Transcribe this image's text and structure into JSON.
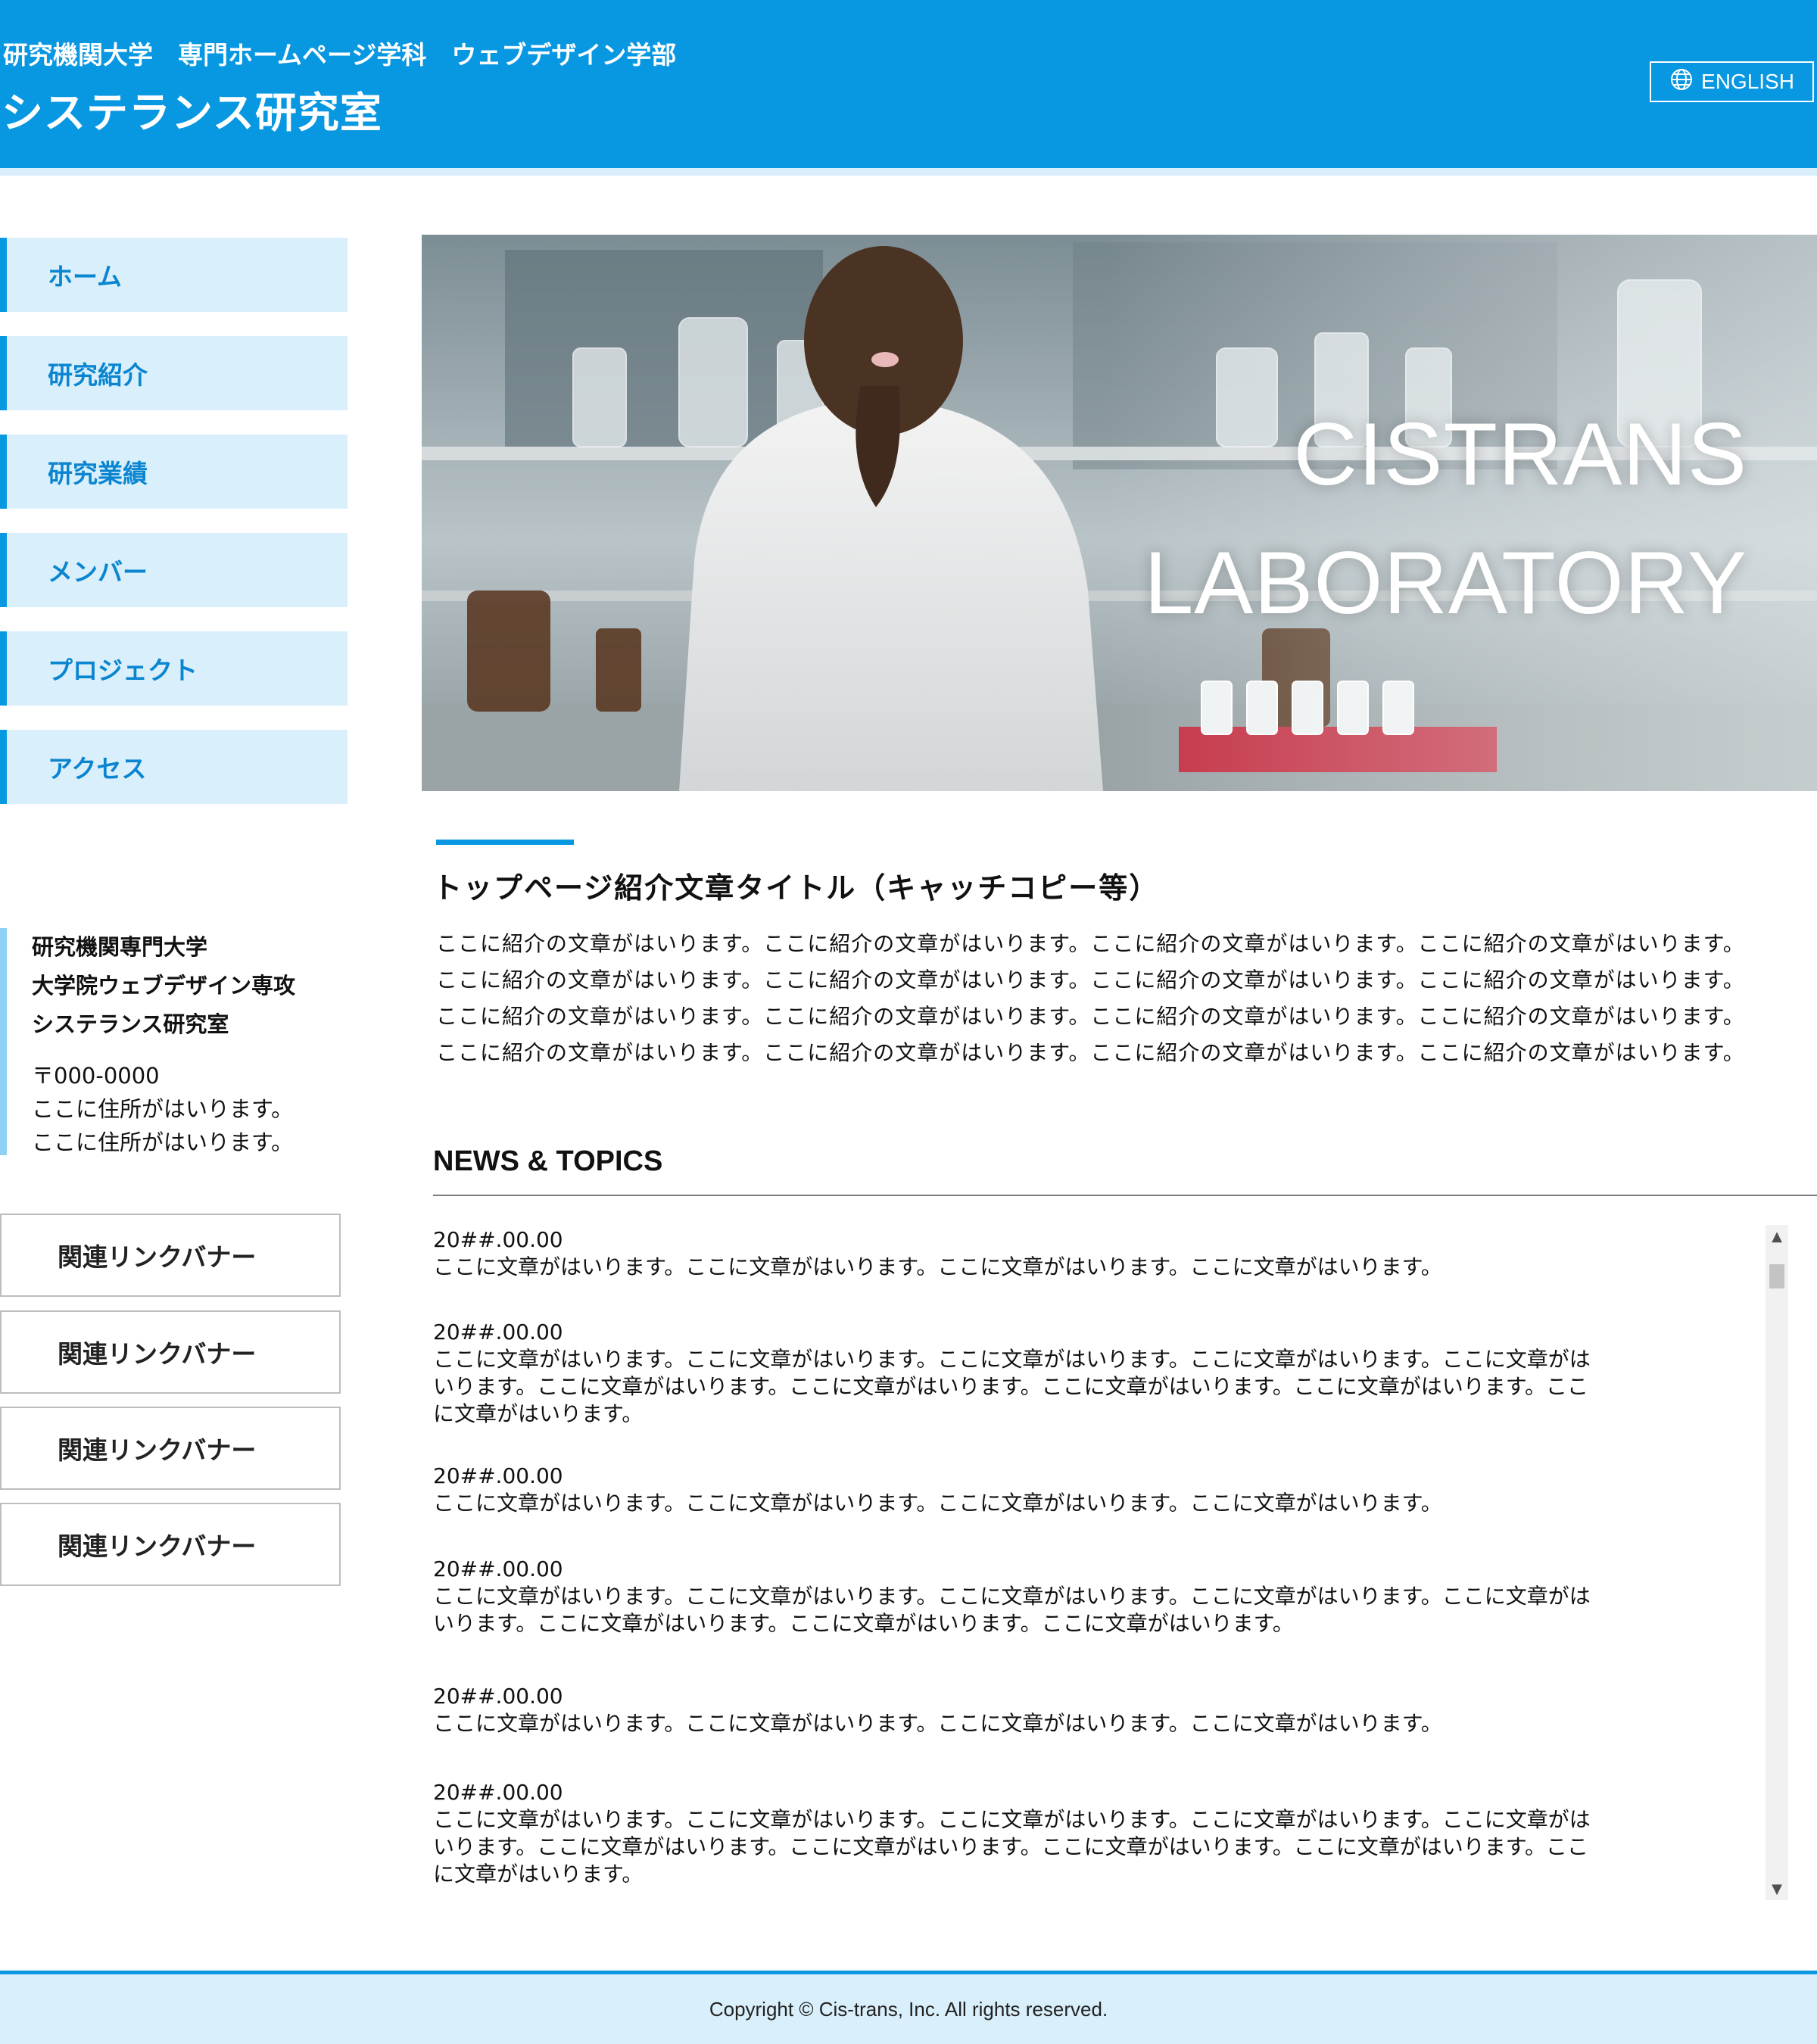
{
  "header": {
    "subtitle": "研究機関大学　専門ホームページ学科　ウェブデザイン学部",
    "title": "システランス研究室",
    "english_label": "ENGLISH",
    "english_icon": "globe-icon"
  },
  "nav": {
    "items": [
      {
        "label": "ホーム"
      },
      {
        "label": "研究紹介"
      },
      {
        "label": "研究業績"
      },
      {
        "label": "メンバー"
      },
      {
        "label": "プロジェクト"
      },
      {
        "label": "アクセス"
      }
    ]
  },
  "address": {
    "line1": "研究機関専門大学",
    "line2": "大学院ウェブデザイン専攻",
    "line3": "システランス研究室",
    "postal": "〒000-0000",
    "street1": "ここに住所がはいります。",
    "street2": "ここに住所がはいります。"
  },
  "banners": [
    {
      "label": "関連リンクバナー"
    },
    {
      "label": "関連リンクバナー"
    },
    {
      "label": "関連リンクバナー"
    },
    {
      "label": "関連リンクバナー"
    }
  ],
  "hero": {
    "line1": "CISTRANS",
    "line2": "LABORATORY"
  },
  "intro": {
    "title": "トップページ紹介文章タイトル（キャッチコピー等）",
    "lines": [
      "ここに紹介の文章がはいります。ここに紹介の文章がはいります。ここに紹介の文章がはいります。ここに紹介の文章がはいります。",
      "ここに紹介の文章がはいります。ここに紹介の文章がはいります。ここに紹介の文章がはいります。ここに紹介の文章がはいります。",
      "ここに紹介の文章がはいります。ここに紹介の文章がはいります。ここに紹介の文章がはいります。ここに紹介の文章がはいります。",
      "ここに紹介の文章がはいります。ここに紹介の文章がはいります。ここに紹介の文章がはいります。ここに紹介の文章がはいります。"
    ]
  },
  "news": {
    "title": "NEWS & TOPICS",
    "items": [
      {
        "date": "20##.00.00",
        "lines": [
          "ここに文章がはいります。ここに文章がはいります。ここに文章がはいります。ここに文章がはいります。"
        ]
      },
      {
        "date": "20##.00.00",
        "lines": [
          "ここに文章がはいります。ここに文章がはいります。ここに文章がはいります。ここに文章がはいります。ここに文章がは",
          "いります。ここに文章がはいります。ここに文章がはいります。ここに文章がはいります。ここに文章がはいります。ここ",
          "に文章がはいります。"
        ]
      },
      {
        "date": "20##.00.00",
        "lines": [
          "ここに文章がはいります。ここに文章がはいります。ここに文章がはいります。ここに文章がはいります。"
        ]
      },
      {
        "date": "20##.00.00",
        "lines": [
          "ここに文章がはいります。ここに文章がはいります。ここに文章がはいります。ここに文章がはいります。ここに文章がは",
          "いります。ここに文章がはいります。ここに文章がはいります。ここに文章がはいります。"
        ]
      },
      {
        "date": "20##.00.00",
        "lines": [
          "ここに文章がはいります。ここに文章がはいります。ここに文章がはいります。ここに文章がはいります。"
        ]
      },
      {
        "date": "20##.00.00",
        "lines": [
          "ここに文章がはいります。ここに文章がはいります。ここに文章がはいります。ここに文章がはいります。ここに文章がは",
          "いります。ここに文章がはいります。ここに文章がはいります。ここに文章がはいります。ここに文章がはいります。ここ",
          "に文章がはいります。"
        ]
      }
    ]
  },
  "footer": {
    "copyright": "Copyright © Cis-trans, Inc. All rights reserved."
  },
  "colors": {
    "accent": "#0897e1",
    "nav_bg": "#d9f0fc",
    "address_bar": "#8fd1f5",
    "text": "#111111"
  }
}
